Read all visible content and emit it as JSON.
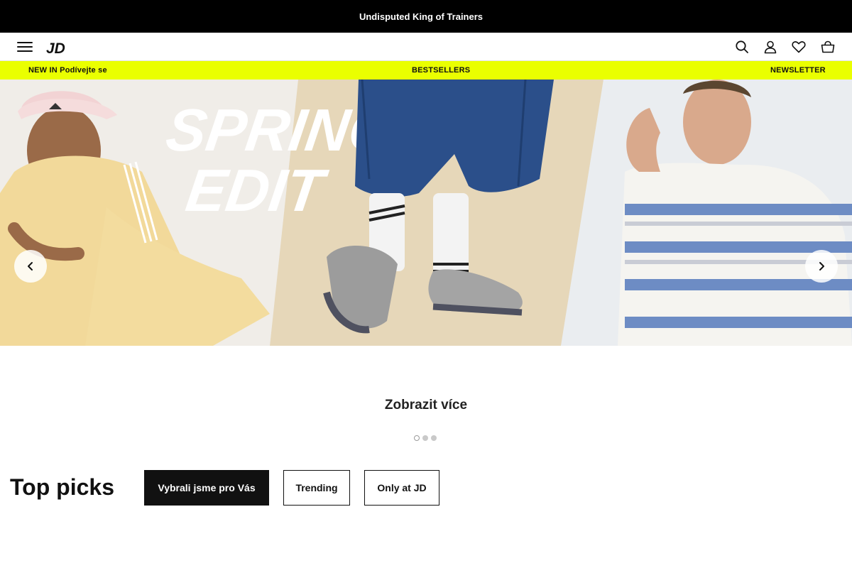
{
  "promo": {
    "text": "Undisputed King of Trainers"
  },
  "header": {
    "menu_icon": "hamburger-menu-icon",
    "logo_text": "JD",
    "icons": [
      "search-icon",
      "user-icon",
      "heart-icon",
      "basket-icon"
    ]
  },
  "subnav": {
    "left": "NEW IN Podívejte se",
    "center": "BESTSELLERS",
    "right": "NEWSLETTER"
  },
  "hero": {
    "headline_line1": "SPRING",
    "headline_line2": "EDIT",
    "prev_icon": "chevron-left-icon",
    "next_icon": "chevron-right-icon"
  },
  "carousel": {
    "view_more": "Zobrazit více",
    "slides": 3,
    "active_slide": 1
  },
  "top_picks": {
    "title": "Top picks",
    "tabs": [
      {
        "label": "Vybrali jsme pro Vás",
        "active": true
      },
      {
        "label": "Trending",
        "active": false
      },
      {
        "label": "Only at JD",
        "active": false
      }
    ]
  },
  "colors": {
    "accent": "#eaff00",
    "promo_bg": "#000000",
    "text": "#111111"
  }
}
